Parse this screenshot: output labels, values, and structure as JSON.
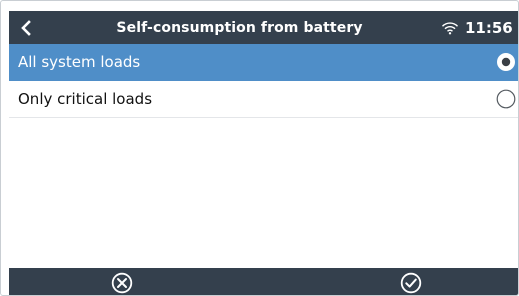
{
  "header": {
    "title": "Self-consumption from battery",
    "time": "11:56",
    "back_icon": "chevron-left-icon",
    "wifi_icon": "wifi-icon"
  },
  "options": [
    {
      "label": "All system loads",
      "selected": true
    },
    {
      "label": "Only critical loads",
      "selected": false
    }
  ],
  "footer": {
    "cancel_icon": "cancel-circle-icon",
    "confirm_icon": "check-circle-icon"
  },
  "colors": {
    "header_bg": "#34404d",
    "selected_bg": "#4f8ec8",
    "text": "#111111"
  }
}
